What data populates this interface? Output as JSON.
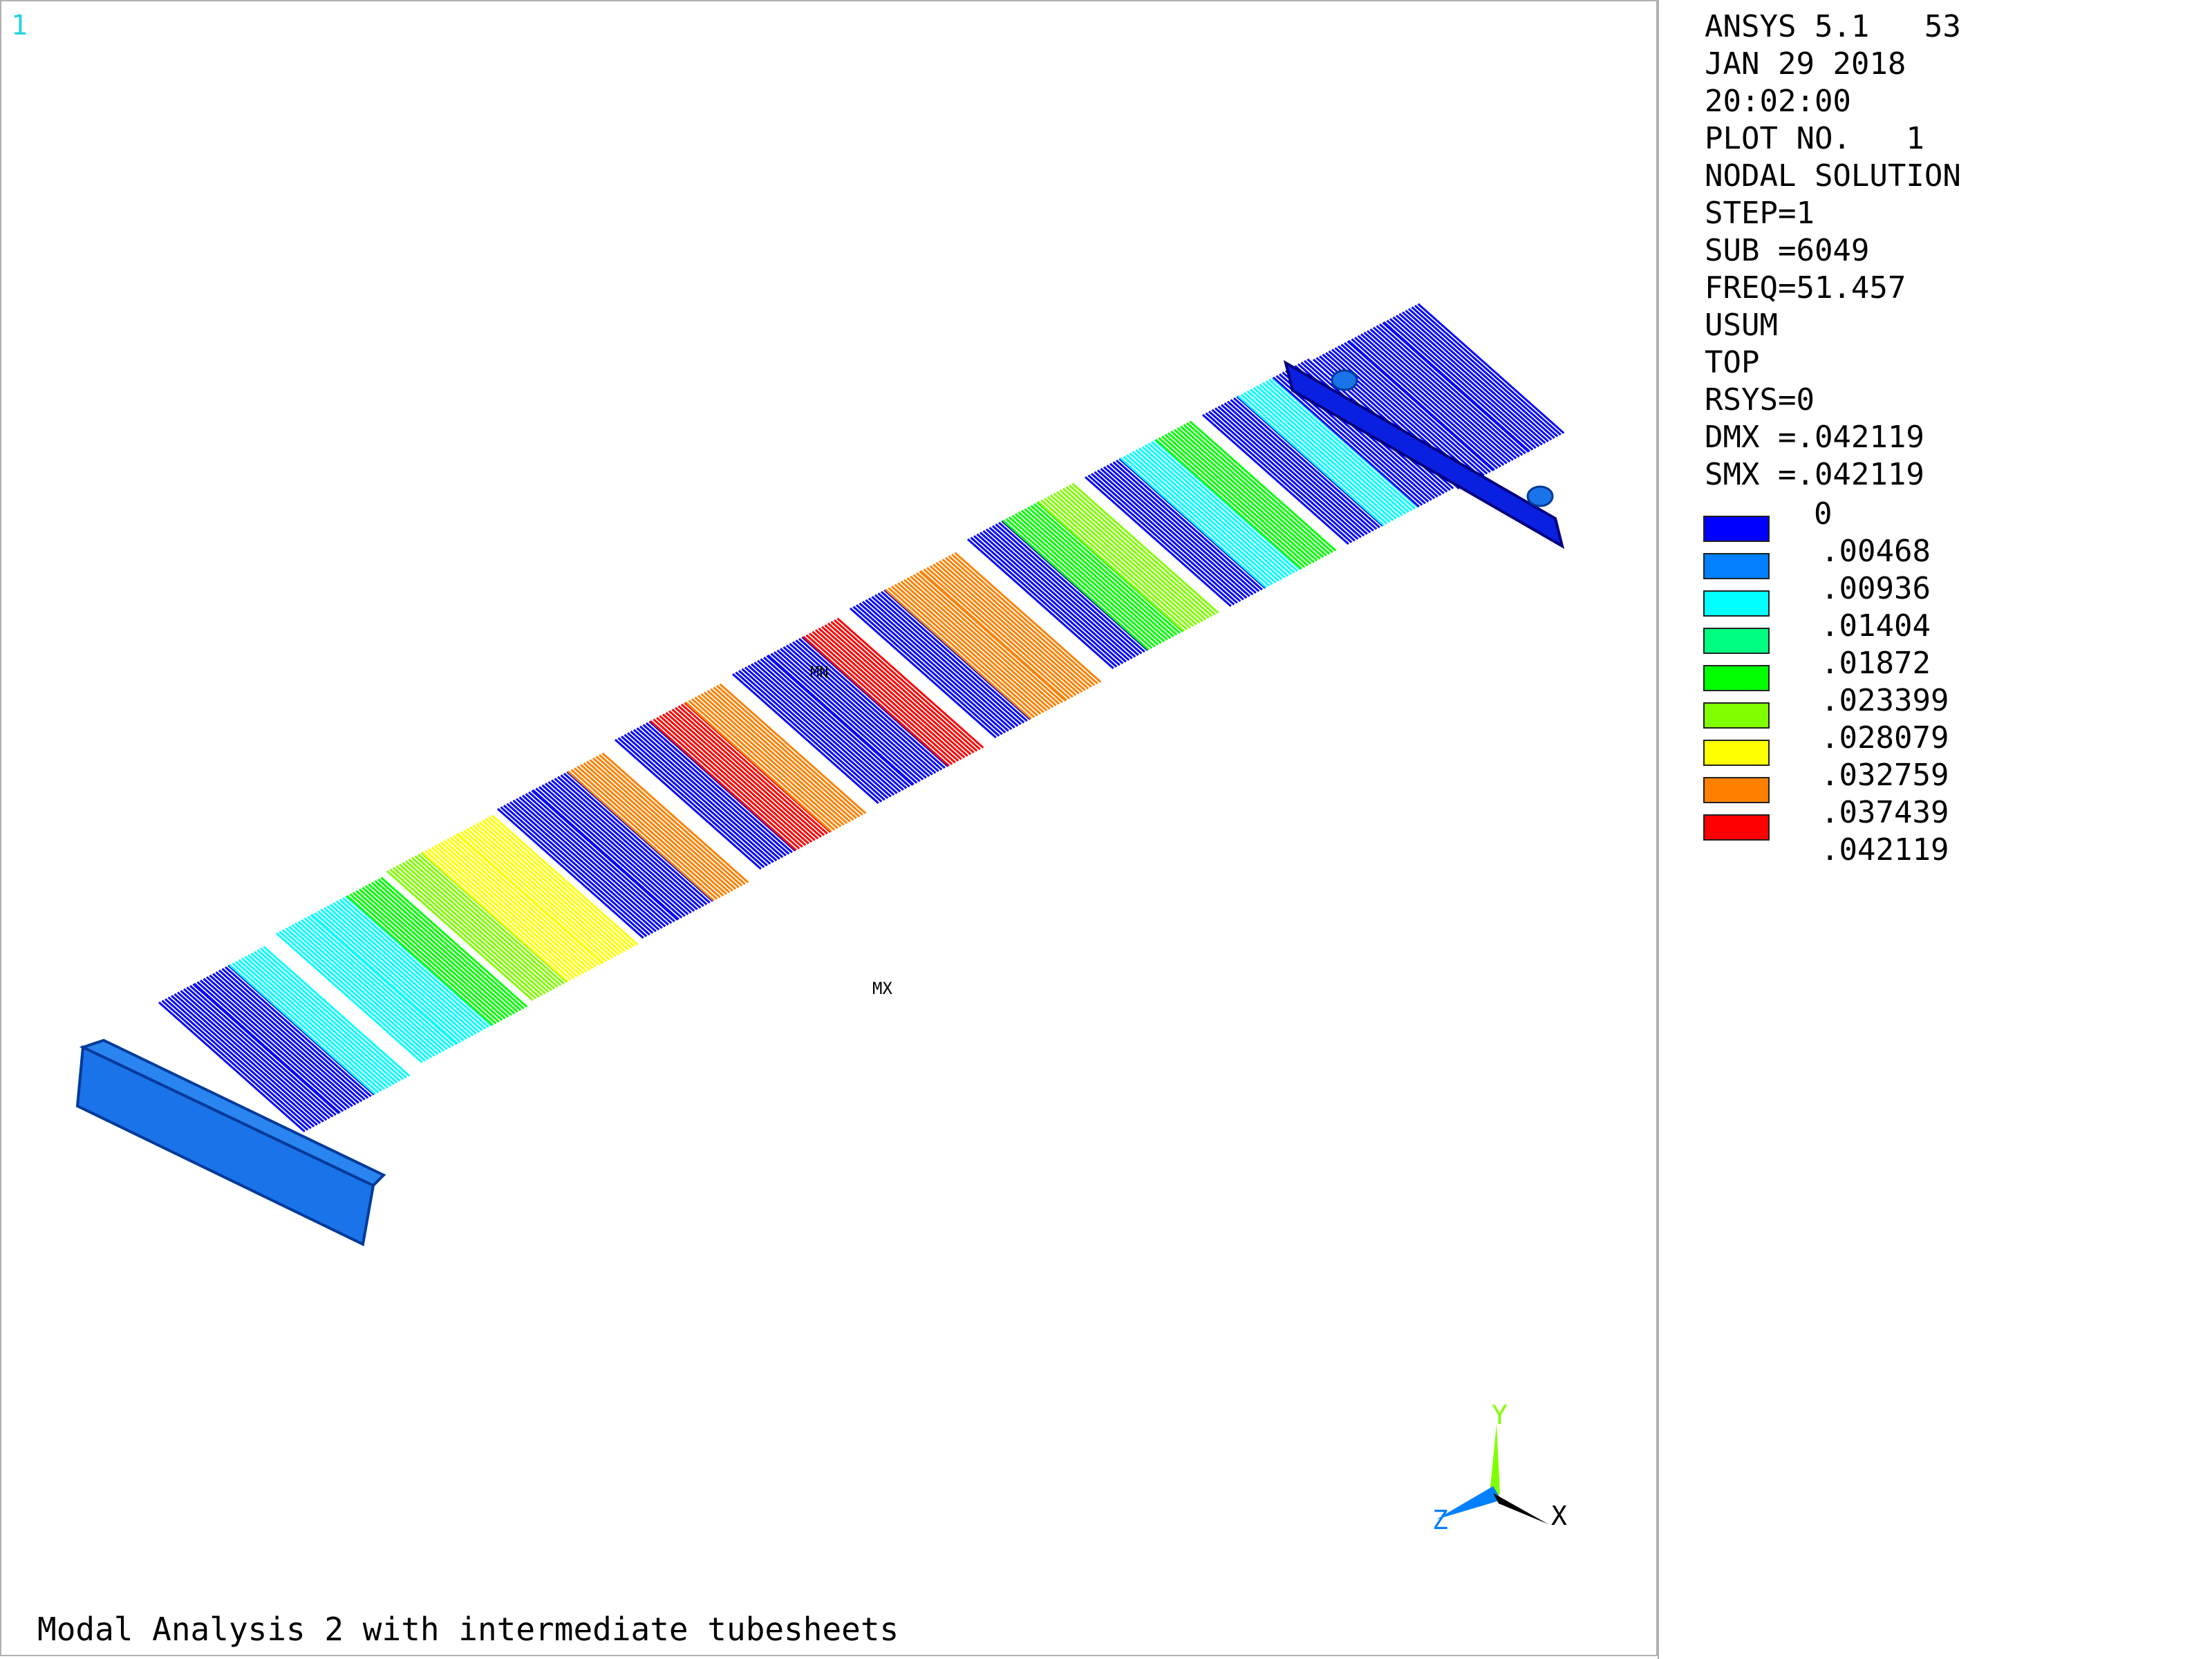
{
  "window_number": "1",
  "info_lines": [
    "ANSYS 5.1   53",
    "JAN 29 2018",
    "20:02:00",
    "PLOT NO.   1",
    "NODAL SOLUTION",
    "STEP=1",
    "SUB =6049",
    "FREQ=51.457",
    "USUM",
    "TOP",
    "RSYS=0",
    "DMX =.042119",
    "SMX =.042119"
  ],
  "legend": {
    "levels": [
      "0",
      ".00468",
      ".00936",
      ".01404",
      ".01872",
      ".023399",
      ".028079",
      ".032759",
      ".037439",
      ".042119"
    ],
    "colors": [
      "#0000ff",
      "#0080ff",
      "#00ffff",
      "#00ff80",
      "#00ff00",
      "#80ff00",
      "#ffff00",
      "#ff8000",
      "#ff0000"
    ]
  },
  "model": {
    "max_label": "MX",
    "min_label": "MN",
    "band_colors": [
      "#0000ff",
      "#00ffff",
      "#00ff00",
      "#80ff00",
      "#ffff00",
      "#ff8000",
      "#ff0000"
    ]
  },
  "triad": {
    "x_label": "X",
    "y_label": "Y",
    "z_label": "Z",
    "x_color": "#000000",
    "y_color": "#80ff00",
    "z_color": "#0080ff"
  },
  "subtitle": "Modal Analysis 2 with intermediate tubesheets"
}
